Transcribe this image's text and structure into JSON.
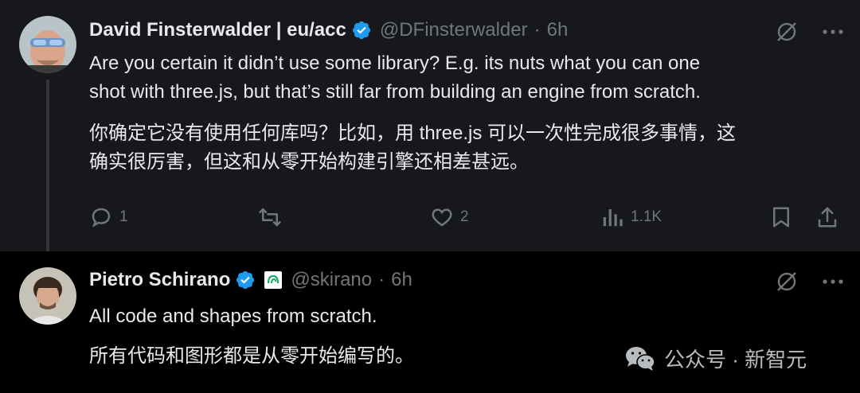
{
  "tweet1": {
    "author_name": "David Finsterwalder | eu/acc",
    "handle": "@DFinsterwalder",
    "separator": "·",
    "time": "6h",
    "text_en_line1": "Are you certain it didn’t use some library? E.g. its nuts what you can one",
    "text_en_line2": "shot with three.js, but that’s still far from building an engine from scratch.",
    "text_zh_line1": "你确定它没有使用任何库吗？比如，用 three.js 可以一次性完成很多事情，这",
    "text_zh_line2": "确实很厉害，但这和从零开始构建引擎还相差甚远。",
    "reply_count": "1",
    "like_count": "2",
    "view_count": "1.1K"
  },
  "tweet2": {
    "author_name": "Pietro Schirano",
    "handle": "@skirano",
    "separator": "·",
    "time": "6h",
    "text_en": "All code and shapes from scratch.",
    "text_zh": "所有代码和图形都是从零开始编写的。"
  },
  "watermark": {
    "text": "公众号 · 新智元"
  },
  "colors": {
    "verified": "#1d9bf0",
    "affiliate_badge": "#1aaa6a",
    "muted": "#71767b"
  }
}
